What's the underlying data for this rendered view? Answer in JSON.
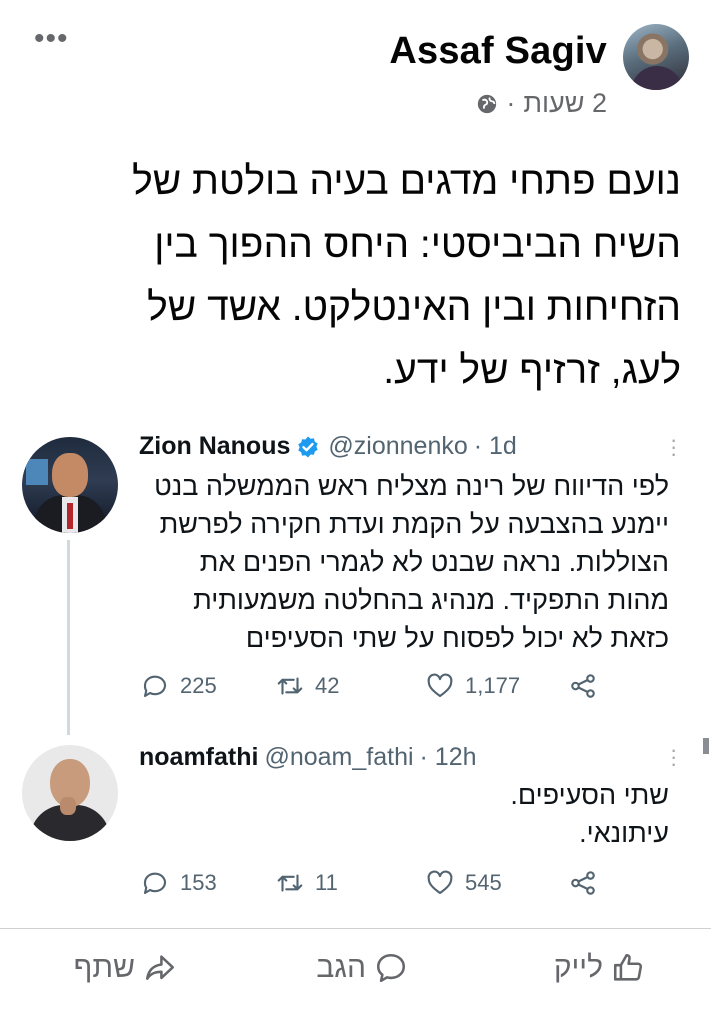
{
  "post": {
    "author": "Assaf Sagiv",
    "time": "2 שעות",
    "separator": "·",
    "more": "•••",
    "text_lines": [
      "נועם פתחי מדגים בעיה בולטת  של",
      "השיח הביביסטי: היחס ההפוך בין",
      "הזחיחות ובין האינטלקט. אשד של",
      "לעג, זרזיף של ידע."
    ]
  },
  "tweets": [
    {
      "name": "Zion Nanous",
      "handle": "@zionnenko",
      "time": "· 1d",
      "verified": true,
      "body_lines": [
        "לפי הדיווח של רינה מצליח ראש הממשלה בנט",
        "יימנע בהצבעה על הקמת ועדת חקירה לפרשת",
        "הצוללות. נראה שבנט לא לגמרי הפנים את",
        "מהות התפקיד. מנהיג בהחלטה משמעותית",
        "כזאת לא יכול לפסוח על שתי הסעיפים"
      ],
      "replies": "225",
      "retweets": "42",
      "likes": "1,177"
    },
    {
      "name": "noamfathi",
      "handle": "@noam_fathi",
      "time": "· 12h",
      "verified": false,
      "body_lines": [
        "שתי הסעיפים.",
        "עיתונאי."
      ],
      "replies": "153",
      "retweets": "11",
      "likes": "545"
    }
  ],
  "actions": {
    "like": "לייק",
    "comment": "הגב",
    "share": "שתף"
  },
  "colors": {
    "text": "#050505",
    "meta": "#65676b",
    "twitter_blue": "#1d9bf0",
    "twitter_gray": "#536471"
  }
}
